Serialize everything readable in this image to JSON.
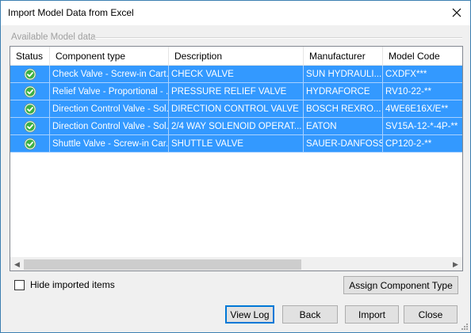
{
  "window": {
    "title": "Import Model Data from Excel",
    "close_icon": "close-icon"
  },
  "group": {
    "label": "Available Model data"
  },
  "table": {
    "columns": [
      "Status",
      "Component type",
      "Description",
      "Manufacturer",
      "Model Code"
    ],
    "rows": [
      {
        "status": "ok",
        "component_type": "Check Valve - Screw-in Cart...",
        "description": "CHECK VALVE",
        "manufacturer": "SUN HYDRAULI...",
        "model_code": "CXDFX***"
      },
      {
        "status": "ok",
        "component_type": "Relief Valve - Proportional - ...",
        "description": "PRESSURE RELIEF VALVE",
        "manufacturer": "HYDRAFORCE",
        "model_code": "RV10-22-**"
      },
      {
        "status": "ok",
        "component_type": "Direction Control Valve - Sol...",
        "description": "DIRECTION CONTROL VALVE",
        "manufacturer": "BOSCH REXRO...",
        "model_code": "4WE6E16X/E**"
      },
      {
        "status": "ok",
        "component_type": "Direction Control Valve - Sol...",
        "description": "2/4 WAY SOLENOID OPERAT...",
        "manufacturer": "EATON",
        "model_code": "SV15A-12-*-4P-**"
      },
      {
        "status": "ok",
        "component_type": "Shuttle Valve - Screw-in Car...",
        "description": "SHUTTLE VALVE",
        "manufacturer": "SAUER-DANFOSS",
        "model_code": "CP120-2-**"
      }
    ],
    "selected_row_color": "#3399ff",
    "status_icon": "check-circle-icon",
    "status_icon_color": "#3cb043"
  },
  "options": {
    "hide_imported_label": "Hide imported items",
    "hide_imported_checked": false
  },
  "buttons": {
    "assign": "Assign Component Type",
    "view_log": "View Log",
    "back": "Back",
    "import": "Import",
    "close": "Close"
  }
}
